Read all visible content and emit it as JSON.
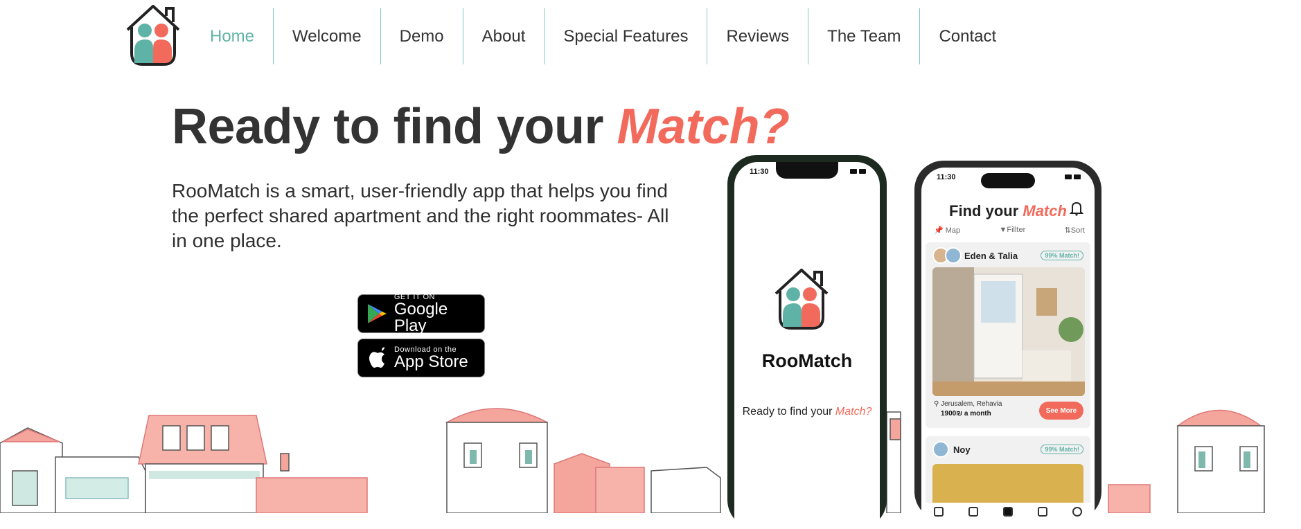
{
  "nav": {
    "items": [
      {
        "label": "Home",
        "active": true
      },
      {
        "label": "Welcome"
      },
      {
        "label": "Demo"
      },
      {
        "label": "About"
      },
      {
        "label": "Special Features"
      },
      {
        "label": "Reviews"
      },
      {
        "label": "The Team"
      },
      {
        "label": "Contact"
      }
    ]
  },
  "hero": {
    "title_main": "Ready to find your ",
    "title_accent": "Match?",
    "description": "RooMatch is a smart, user-friendly app that helps you find the perfect shared apartment and the right roommates- All in one place."
  },
  "stores": {
    "google": {
      "small": "GET IT ON",
      "big": "Google Play"
    },
    "apple": {
      "small": "Download on the",
      "big": "App Store"
    }
  },
  "phone_splash": {
    "time": "11:30",
    "app_name": "RooMatch",
    "tagline_main": "Ready to find your ",
    "tagline_accent": "Match?"
  },
  "phone_app": {
    "time": "11:30",
    "title_main": "Find your ",
    "title_accent": "Match",
    "toolbar": {
      "map": "Map",
      "filter": "Fillter",
      "sort": "Sort"
    },
    "card1": {
      "names": "Eden & Talia",
      "match": "99% Match!",
      "location": "Jerusalem, Rehavia",
      "price": "1900₪ a month",
      "cta": "See More"
    },
    "card2": {
      "names": "Noy",
      "match": "99% Match!"
    }
  },
  "colors": {
    "brand_teal": "#5fb3a6",
    "brand_coral": "#f26a5c",
    "text_dark": "#333333"
  }
}
